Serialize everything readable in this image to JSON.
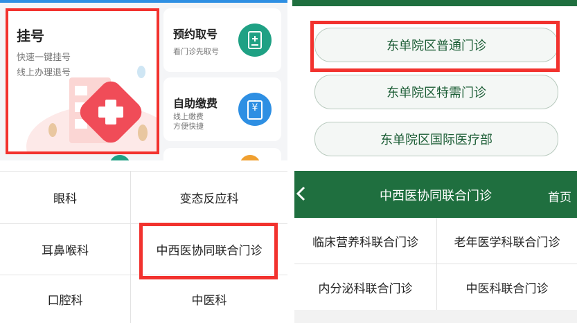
{
  "registration_home": {
    "main_card": {
      "title": "挂号",
      "line1": "快速一键挂号",
      "line2": "线上办理退号"
    },
    "appointment_card": {
      "title": "预约取号",
      "subtitle": "看门诊先取号"
    },
    "payment_card": {
      "title": "自助缴费",
      "subtitle_line1": "线上缴费",
      "subtitle_line2": "方便快捷",
      "icon_glyph": "¥"
    }
  },
  "campus_list": {
    "items": [
      "东单院区普通门诊",
      "东单院区特需门诊",
      "东单院区国际医疗部"
    ]
  },
  "department_grid": {
    "rows": [
      [
        "眼科",
        "变态反应科"
      ],
      [
        "耳鼻喉科",
        "中西医协同联合门诊"
      ],
      [
        "口腔科",
        "中医科"
      ]
    ]
  },
  "joint_clinic": {
    "nav": {
      "back_glyph": "<",
      "title": "中西医协同联合门诊",
      "home_label": "首页"
    },
    "rows": [
      [
        "临床营养科联合门诊",
        "老年医学科联合门诊"
      ],
      [
        "内分泌科联合门诊",
        "中医科联合门诊"
      ]
    ]
  },
  "colors": {
    "highlight_red": "#f2322e",
    "brand_green": "#1f6f3f",
    "teal_icon": "#1fa184",
    "blue_icon": "#2e8fe3"
  }
}
